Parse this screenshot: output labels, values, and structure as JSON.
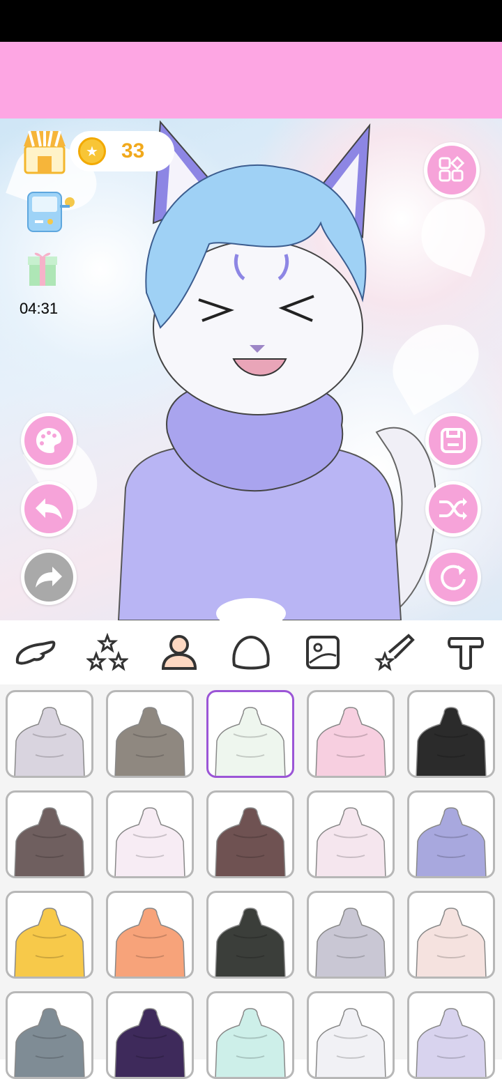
{
  "coins": "33",
  "timer": "04:31",
  "tabs": [
    {
      "icon": "wing-icon"
    },
    {
      "icon": "stars-icon"
    },
    {
      "icon": "body-icon",
      "active": true
    },
    {
      "icon": "head-icon"
    },
    {
      "icon": "background-icon"
    },
    {
      "icon": "shooting-star-icon"
    },
    {
      "icon": "text-icon"
    }
  ],
  "colors": {
    "pink_accent": "#f6a3d9",
    "header_pink": "#fda6e3",
    "selected_border": "#9b55d6",
    "coin_text": "#f1a91c"
  },
  "swatches": [
    "#d9d4df",
    "#8f8880",
    "#eef6ee",
    "#f7cfe0",
    "#2b2b2b",
    "#6f5f5f",
    "#f7ecf4",
    "#6f5252",
    "#f5e6ee",
    "#a8a8de",
    "#f7c94a",
    "#f7a37a",
    "#3b3e3a",
    "#c9c7d4",
    "#f5e2df",
    "#7f8c95",
    "#3e2a5b",
    "#cdefe9",
    "#f1f1f5",
    "#d8d3ee"
  ],
  "selected_swatch": 2
}
